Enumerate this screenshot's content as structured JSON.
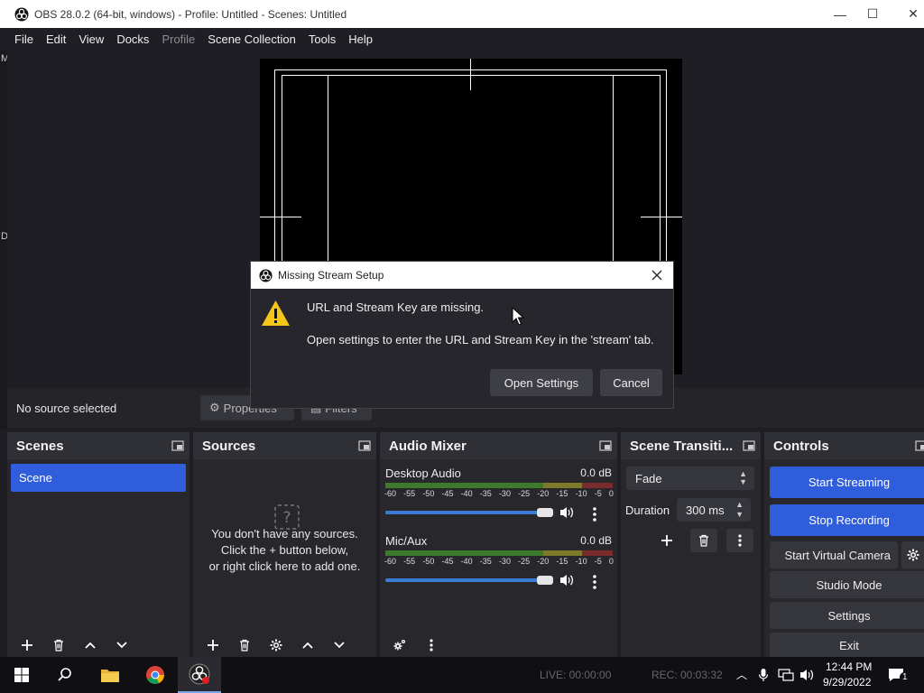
{
  "window": {
    "title": "OBS 28.0.2 (64-bit, windows) - Profile: Untitled - Scenes: Untitled",
    "minimize": "—",
    "maximize": "☐",
    "close": "✕"
  },
  "menu": [
    "File",
    "Edit",
    "View",
    "Docks",
    "Profile",
    "Scene Collection",
    "Tools",
    "Help"
  ],
  "gutter": [
    "M",
    "D"
  ],
  "sourcebar": {
    "no_source": "No source selected",
    "properties": "Properties",
    "filters": "Filters"
  },
  "scenes": {
    "title": "Scenes",
    "items": [
      "Scene"
    ]
  },
  "sources": {
    "title": "Sources",
    "empty_line1": "You don't have any sources.",
    "empty_line2": "Click the + button below,",
    "empty_line3": "or right click here to add one."
  },
  "mixer": {
    "title": "Audio Mixer",
    "scale": [
      "-60",
      "-55",
      "-50",
      "-45",
      "-40",
      "-35",
      "-30",
      "-25",
      "-20",
      "-15",
      "-10",
      "-5",
      "0"
    ],
    "channels": [
      {
        "name": "Desktop Audio",
        "db": "0.0 dB",
        "volume": 1.0
      },
      {
        "name": "Mic/Aux",
        "db": "0.0 dB",
        "volume": 1.0
      }
    ]
  },
  "transitions": {
    "title": "Scene Transiti...",
    "selected": "Fade",
    "duration_label": "Duration",
    "duration_value": "300 ms"
  },
  "controls": {
    "title": "Controls",
    "start_streaming": "Start Streaming",
    "stop_recording": "Stop Recording",
    "start_virtual_camera": "Start Virtual Camera",
    "studio_mode": "Studio Mode",
    "settings": "Settings",
    "exit": "Exit"
  },
  "status": {
    "live": "LIVE: 00:00:00",
    "rec": "REC: 00:03:32"
  },
  "taskbar": {
    "time": "12:44 PM",
    "date": "9/29/2022",
    "notification_count": "1"
  },
  "dialog": {
    "title": "Missing Stream Setup",
    "message1": "URL and Stream Key are missing.",
    "message2": "Open settings to enter the URL and Stream Key in the 'stream' tab.",
    "open_settings": "Open Settings",
    "cancel": "Cancel"
  },
  "colors": {
    "accent": "#2f5ddc",
    "background": "#1e1e24",
    "warning": "#f5c518"
  }
}
